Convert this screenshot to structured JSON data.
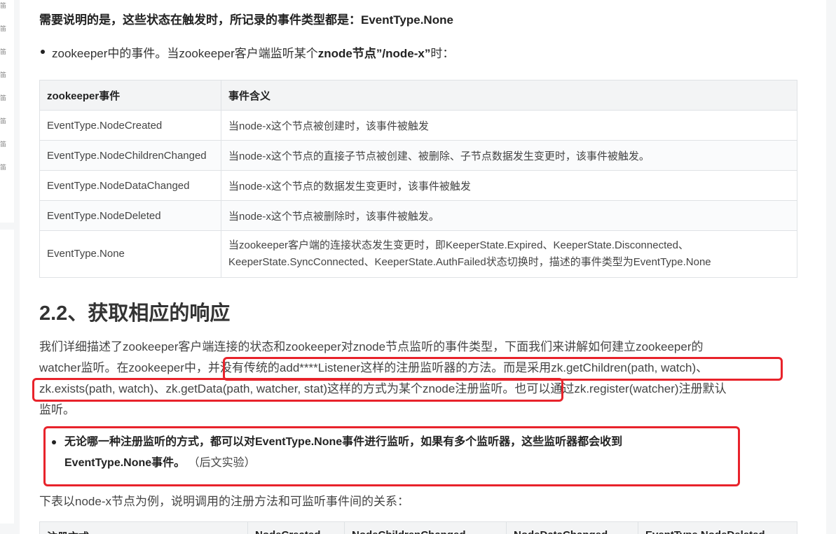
{
  "left_sidebar": {
    "marks": [
      "笛",
      "笛",
      "笛",
      "笛",
      "笛",
      "笛",
      "笛",
      "笛"
    ]
  },
  "note": "需要说明的是，这些状态在触发时，所记录的事件类型都是：EventType.None",
  "bullet_events": {
    "prefix": "zookeeper中的事件。当zookeeper客户端监听某个",
    "bold": "znode节点”/node-x”",
    "suffix": "时："
  },
  "events_table": {
    "headers": [
      "zookeeper事件",
      "事件含义"
    ],
    "rows": [
      [
        "EventType.NodeCreated",
        "当node-x这个节点被创建时，该事件被触发"
      ],
      [
        "EventType.NodeChildrenChanged",
        "当node-x这个节点的直接子节点被创建、被删除、子节点数据发生变更时，该事件被触发。"
      ],
      [
        "EventType.NodeDataChanged",
        "当node-x这个节点的数据发生变更时，该事件被触发"
      ],
      [
        "EventType.NodeDeleted",
        "当node-x这个节点被删除时，该事件被触发。"
      ]
    ],
    "last_row": {
      "event": "EventType.None",
      "line1": "当zookeeper客户端的连接状态发生变更时，即KeeperState.Expired、KeeperState.Disconnected、",
      "line2": "KeeperState.SyncConnected、KeeperState.AuthFailed状态切换时，描述的事件类型为EventType.None"
    }
  },
  "section_heading": "2.2、获取相应的响应",
  "paragraph": {
    "line1": "我们详细描述了zookeeper客户端连接的状态和zookeeper对znode节点监听的事件类型，下面我们来讲解如何建立zookeeper的",
    "line2": "watcher监听。在zookeeper中，并没有传统的add****Listener这样的注册监听器的方法。而是采用zk.getChildren(path, watch)、",
    "line3": "zk.exists(path, watch)、zk.getData(path, watcher, stat)这样的方式为某个znode注册监听。也可以通过zk.register(watcher)注册默认",
    "line4": "监听。"
  },
  "bullet_highlight": {
    "bold1": "无论哪一种注册监听的方式，都可以对EventType.None事件进行监听，如果有多个监听器，这些监听器都会收到",
    "bold2": "EventType.None事件。",
    "normal": "（后文实验）"
  },
  "paragraph2": "下表以node-x节点为例，说明调用的注册方法和可监听事件间的关系：",
  "relation_table": {
    "headers": [
      "注册方式",
      "NodeCreated",
      "NodeChildrenChanged",
      "NodeDataChanged",
      "EventType.NodeDeleted"
    ]
  },
  "colors": {
    "highlight_box": "#e8232b",
    "table_header_bg": "#f3f4f5",
    "border": "#dfe2e5"
  }
}
